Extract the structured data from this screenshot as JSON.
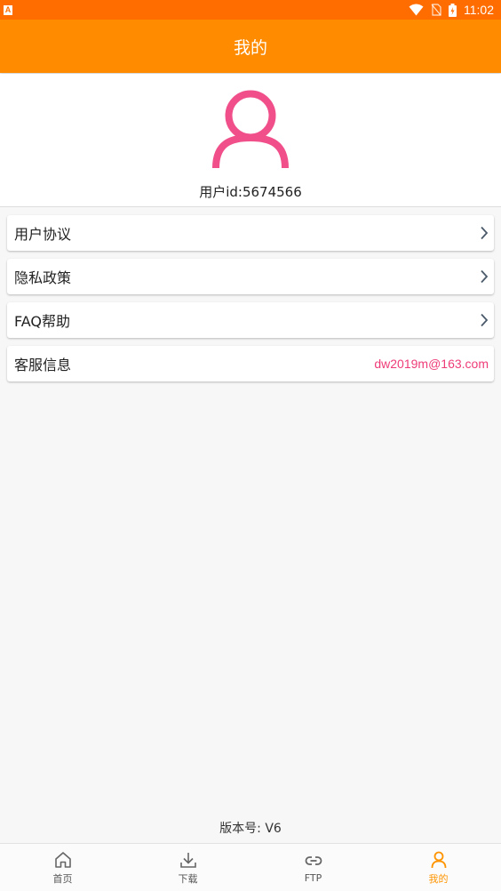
{
  "status_bar": {
    "left_badge": "A",
    "time": "11:02",
    "icons": [
      "wifi-icon",
      "no-sim-icon",
      "battery-charging-icon"
    ]
  },
  "header": {
    "title": "我的"
  },
  "profile": {
    "user_id": "用户id:5674566",
    "avatar_icon": "user-avatar-icon"
  },
  "menu": {
    "items": [
      {
        "label": "用户协议",
        "trailing_icon": "chevron-right-icon"
      },
      {
        "label": "隐私政策",
        "trailing_icon": "chevron-right-icon"
      },
      {
        "label": "FAQ帮助",
        "trailing_icon": "chevron-right-icon"
      },
      {
        "label": "客服信息",
        "value": "dw2019m@163.com"
      }
    ]
  },
  "version": "版本号: V6",
  "bottom_nav": {
    "items": [
      {
        "label": "首页",
        "icon": "home-icon"
      },
      {
        "label": "下载",
        "icon": "download-icon"
      },
      {
        "label": "FTP",
        "icon": "link-icon"
      },
      {
        "label": "我的",
        "icon": "person-icon",
        "active": true
      }
    ]
  },
  "colors": {
    "status_bar": "#ff6d00",
    "header": "#ff8c00",
    "accent_pink": "#ee3c78",
    "active_tab": "#ff9400"
  }
}
